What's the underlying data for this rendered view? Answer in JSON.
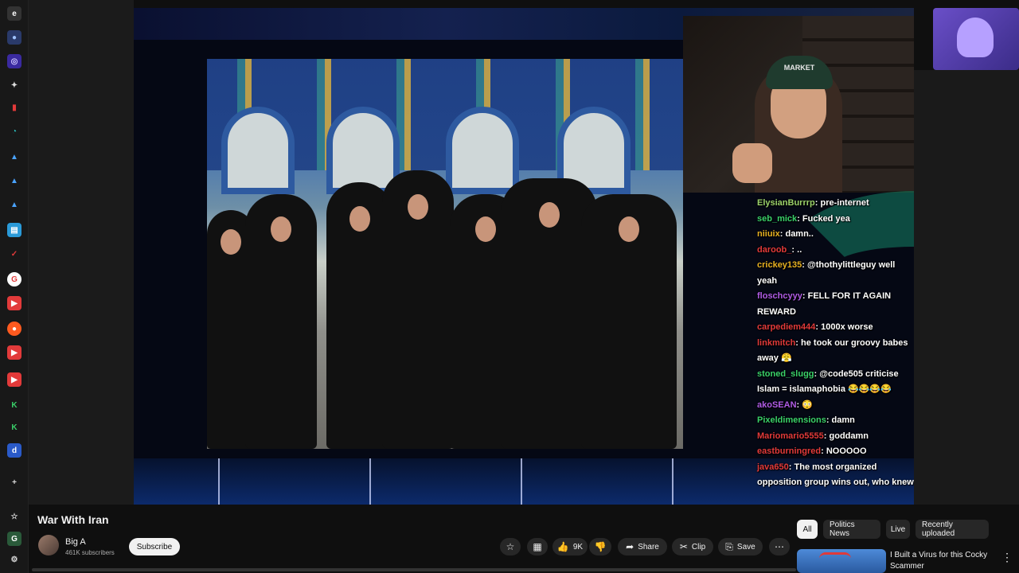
{
  "video": {
    "title": "War With Iran"
  },
  "channel": {
    "name": "Big A",
    "subscribers": "461K subscribers",
    "subscribe_label": "Subscribe"
  },
  "actions": {
    "like_count": "9K",
    "share_label": "Share",
    "clip_label": "Clip",
    "save_label": "Save",
    "more_label": "⋯"
  },
  "webcam": {
    "cap_text": "MARKET"
  },
  "chat": {
    "messages": [
      {
        "user": "ElysianBurrrp",
        "color": "#9bd16a",
        "text": "pre-internet"
      },
      {
        "user": "seb_mick",
        "color": "#3ad16a",
        "text": "Fucked yea"
      },
      {
        "user": "niiuix",
        "color": "#e6b022",
        "text": "damn.."
      },
      {
        "user": "daroob_",
        "color": "#e23a3a",
        "text": ".."
      },
      {
        "user": "crickey135",
        "color": "#e6b022",
        "text": "@thothylittleguy well yeah"
      },
      {
        "user": "floschcyyy",
        "color": "#b05ce6",
        "text": "FELL FOR IT AGAIN REWARD"
      },
      {
        "user": "carpediem444",
        "color": "#e23a3a",
        "text": "1000x worse"
      },
      {
        "user": "linkmitch",
        "color": "#e23a3a",
        "text": "he took our groovy babes away 😤"
      },
      {
        "user": "stoned_slugg",
        "color": "#3ad16a",
        "text": "@code505 criticise Islam = islamaphobia 😂😂😂😂"
      },
      {
        "user": "akoSEAN",
        "color": "#b05ce6",
        "text": "😳"
      },
      {
        "user": "Pixeldimensions",
        "color": "#3ad16a",
        "text": "damn"
      },
      {
        "user": "Mariomario5555",
        "color": "#e23a3a",
        "text": "goddamn"
      },
      {
        "user": "eastburningred",
        "color": "#e23a3a",
        "text": "NOOOOO"
      },
      {
        "user": "java650",
        "color": "#e23a3a",
        "text": "The most organized opposition group wins out, who knew"
      }
    ]
  },
  "filters": {
    "chips": [
      "All",
      "Politics News",
      "Live",
      "Recently uploaded"
    ]
  },
  "recommendation": {
    "title": "I Built a Virus for this Cocky Scammer"
  },
  "icons": {
    "star": "☆",
    "grid": "▦",
    "like": "👍",
    "dislike": "👎",
    "share": "➦",
    "clip": "✂",
    "save": "⎘",
    "more_vert": "⋮"
  }
}
